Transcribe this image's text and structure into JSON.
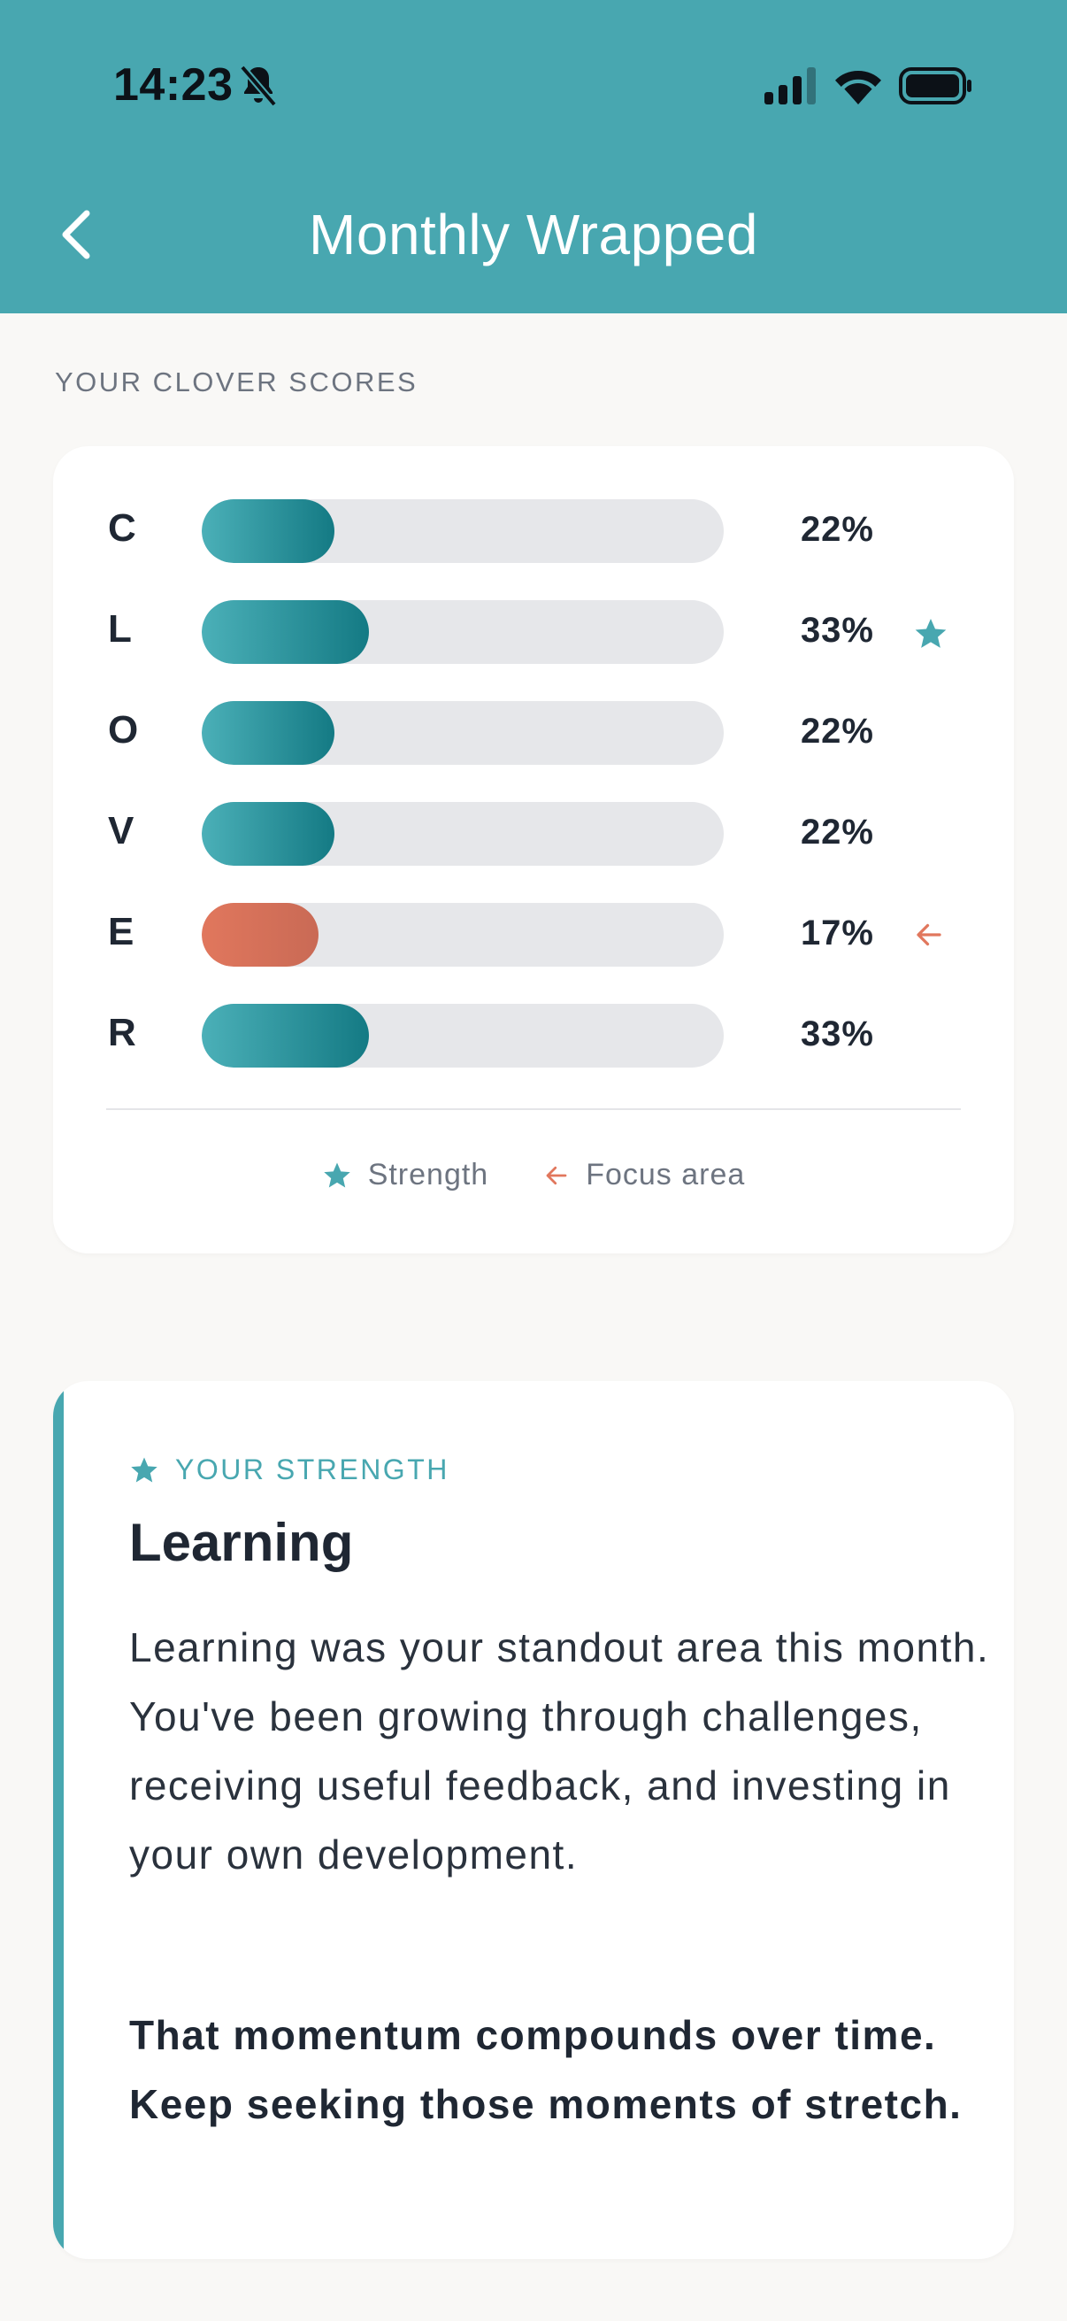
{
  "status_bar": {
    "time": "14:23",
    "icons": [
      "bell-off-icon",
      "signal-icon",
      "wifi-icon",
      "battery-icon"
    ]
  },
  "header": {
    "title": "Monthly Wrapped",
    "back_icon": "chevron-left-icon"
  },
  "scores": {
    "section_label": "YOUR CLOVER SCORES",
    "rows": [
      {
        "letter": "C",
        "percent_label": "22%",
        "fraction": 0.22,
        "marker": "none"
      },
      {
        "letter": "L",
        "percent_label": "33%",
        "fraction": 0.33,
        "marker": "strength"
      },
      {
        "letter": "O",
        "percent_label": "22%",
        "fraction": 0.22,
        "marker": "none"
      },
      {
        "letter": "V",
        "percent_label": "22%",
        "fraction": 0.22,
        "marker": "none"
      },
      {
        "letter": "E",
        "percent_label": "17%",
        "fraction": 0.17,
        "marker": "focus"
      },
      {
        "letter": "R",
        "percent_label": "33%",
        "fraction": 0.33,
        "marker": "none"
      }
    ],
    "legend": {
      "strength_label": "Strength",
      "focus_label": "Focus area"
    }
  },
  "strength_card": {
    "kicker": "YOUR STRENGTH",
    "title": "Learning",
    "body": "Learning was your standout area this month. You've been growing through challenges, receiving useful feedback, and investing in your own development.",
    "closing": "That momentum compounds over time. Keep seeking those moments of stretch."
  },
  "colors": {
    "header_bg": "#48a7b0",
    "bar_fill_start": "#4bb0b8",
    "bar_fill_end": "#147a84",
    "focus_fill": "#e1775d",
    "track": "#e6e7ea",
    "page_bg": "#f9f8f6"
  }
}
